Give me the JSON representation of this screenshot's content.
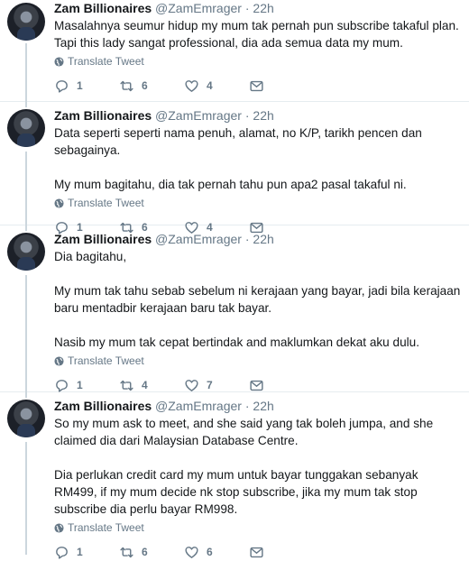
{
  "tweets": [
    {
      "name": "Zam Billionaires",
      "handle": "@ZamEmrager",
      "dot": "·",
      "time": "22h",
      "paragraphs": [
        "Masalahnya seumur hidup my mum tak pernah pun subscribe takaful plan. Tapi this lady sangat professional, dia ada semua data my mum."
      ],
      "translate": "Translate Tweet",
      "replies": "1",
      "retweets": "6",
      "likes": "4"
    },
    {
      "name": "Zam Billionaires",
      "handle": "@ZamEmrager",
      "dot": "·",
      "time": "22h",
      "paragraphs": [
        "Data seperti seperti nama penuh, alamat, no K/P, tarikh pencen dan sebagainya.",
        "My mum bagitahu, dia tak pernah tahu pun apa2 pasal takaful ni."
      ],
      "translate": "Translate Tweet",
      "replies": "1",
      "retweets": "6",
      "likes": "4"
    },
    {
      "name": "Zam Billionaires",
      "handle": "@ZamEmrager",
      "dot": "·",
      "time": "22h",
      "paragraphs": [
        "Dia bagitahu,",
        "My mum tak tahu sebab sebelum ni kerajaan yang bayar, jadi bila kerajaan baru mentadbir kerajaan baru tak bayar.",
        "Nasib my mum tak cepat bertindak and maklumkan dekat aku dulu."
      ],
      "translate": "Translate Tweet",
      "replies": "1",
      "retweets": "4",
      "likes": "7"
    },
    {
      "name": "Zam Billionaires",
      "handle": "@ZamEmrager",
      "dot": "·",
      "time": "22h",
      "paragraphs": [
        "So my mum ask to meet, and she said yang tak boleh jumpa, and she claimed dia dari Malaysian Database Centre.",
        "Dia perlukan credit card my mum untuk bayar tunggakan sebanyak RM499, if my mum decide nk stop subscribe, jika my mum tak stop subscribe dia perlu bayar RM998."
      ],
      "translate": "Translate Tweet",
      "replies": "1",
      "retweets": "6",
      "likes": "6"
    }
  ]
}
